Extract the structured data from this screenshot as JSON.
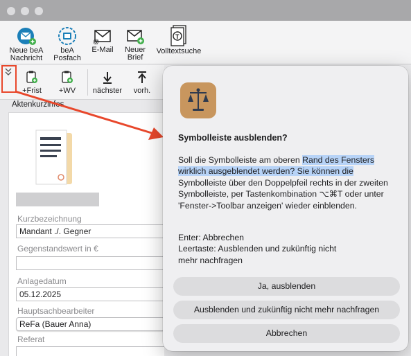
{
  "toolbar": {
    "new_bea": "Neue beA\nNachricht",
    "bea_posfach": "beA\nPosfach",
    "email": "E-Mail",
    "new_letter": "Neuer\nBrief",
    "fulltext": "Volltextsuche",
    "frist": "+Frist",
    "wv": "+WV",
    "next": "nächster",
    "prev": "vorh."
  },
  "panel": {
    "section_title": "Aktenkurzinfos",
    "fields": [
      {
        "label": "Kurzbezeichnung",
        "value": "Mandant ./. Gegner"
      },
      {
        "label": "Gegenstandswert in €",
        "value": ""
      },
      {
        "label": "Anlagedatum",
        "value": "05.12.2025"
      },
      {
        "label": "Hauptsachbearbeiter",
        "value": "ReFa (Bauer Anna)"
      },
      {
        "label": "Referat",
        "value": ""
      }
    ]
  },
  "dialog": {
    "title": "Symbolleiste ausblenden?",
    "text_before": "Soll die Symbolleiste am oberen ",
    "text_highlight": "Rand des Fensters wirklich ausgeblendet werden? Sie können die",
    "text_after": " Symbolleiste über den Doppelpfeil rechts in der zweiten Symbolleiste, per Tastenkombination ⌥⌘T oder unter 'Fenster->Toolbar anzeigen' wieder einblenden.",
    "hint": "Enter: Abbrechen\nLeertaste: Ausblenden und zukünftig nicht\nmehr nachfragen",
    "buttons": {
      "hide": "Ja, ausblenden",
      "hide_forever": "Ausblenden und zukünftig nicht mehr nachfragen",
      "cancel": "Abbrechen"
    }
  },
  "colors": {
    "accent_red": "#e8472b",
    "highlight": "#b7d3f7",
    "bea_blue": "#1b7fb8",
    "app_icon": "#c8965e"
  }
}
